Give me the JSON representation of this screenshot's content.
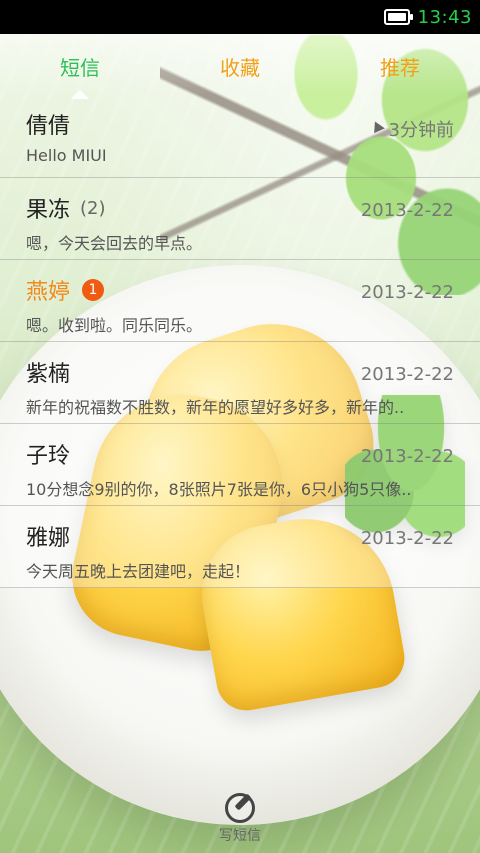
{
  "status_bar": {
    "time": "13:43",
    "icons": [
      "battery-icon"
    ]
  },
  "tabs": [
    {
      "label": "短信",
      "active": true
    },
    {
      "label": "收藏",
      "active": false
    },
    {
      "label": "推荐",
      "active": false
    }
  ],
  "messages": [
    {
      "name": "倩倩",
      "count": "",
      "unread_badge": "",
      "time": "3分钟前",
      "preview": "Hello MIUI"
    },
    {
      "name": "果冻",
      "count": "(2)",
      "unread_badge": "",
      "time": "2013-2-22",
      "preview": "嗯，今天会回去的早点。"
    },
    {
      "name": "燕婷",
      "count": "",
      "unread_badge": "1",
      "time": "2013-2-22",
      "preview": "嗯。收到啦。同乐同乐。"
    },
    {
      "name": "紫楠",
      "count": "",
      "unread_badge": "",
      "time": "2013-2-22",
      "preview": "新年的祝福数不胜数，新年的愿望好多好多，新年的.."
    },
    {
      "name": "子玲",
      "count": "",
      "unread_badge": "",
      "time": "2013-2-22",
      "preview": "10分想念9别的你，8张照片7张是你，6只小狗5只像.."
    },
    {
      "name": "雅娜",
      "count": "",
      "unread_badge": "",
      "time": "2013-2-22",
      "preview": "今天周五晚上去团建吧，走起！"
    }
  ],
  "compose": {
    "label": "写短信"
  },
  "colors": {
    "status_time": "#28d04a",
    "tab_active": "#2cbf54",
    "tab_inactive": "#f3a019",
    "badge": "#f05a12",
    "highlight_name": "#f08a1a"
  }
}
